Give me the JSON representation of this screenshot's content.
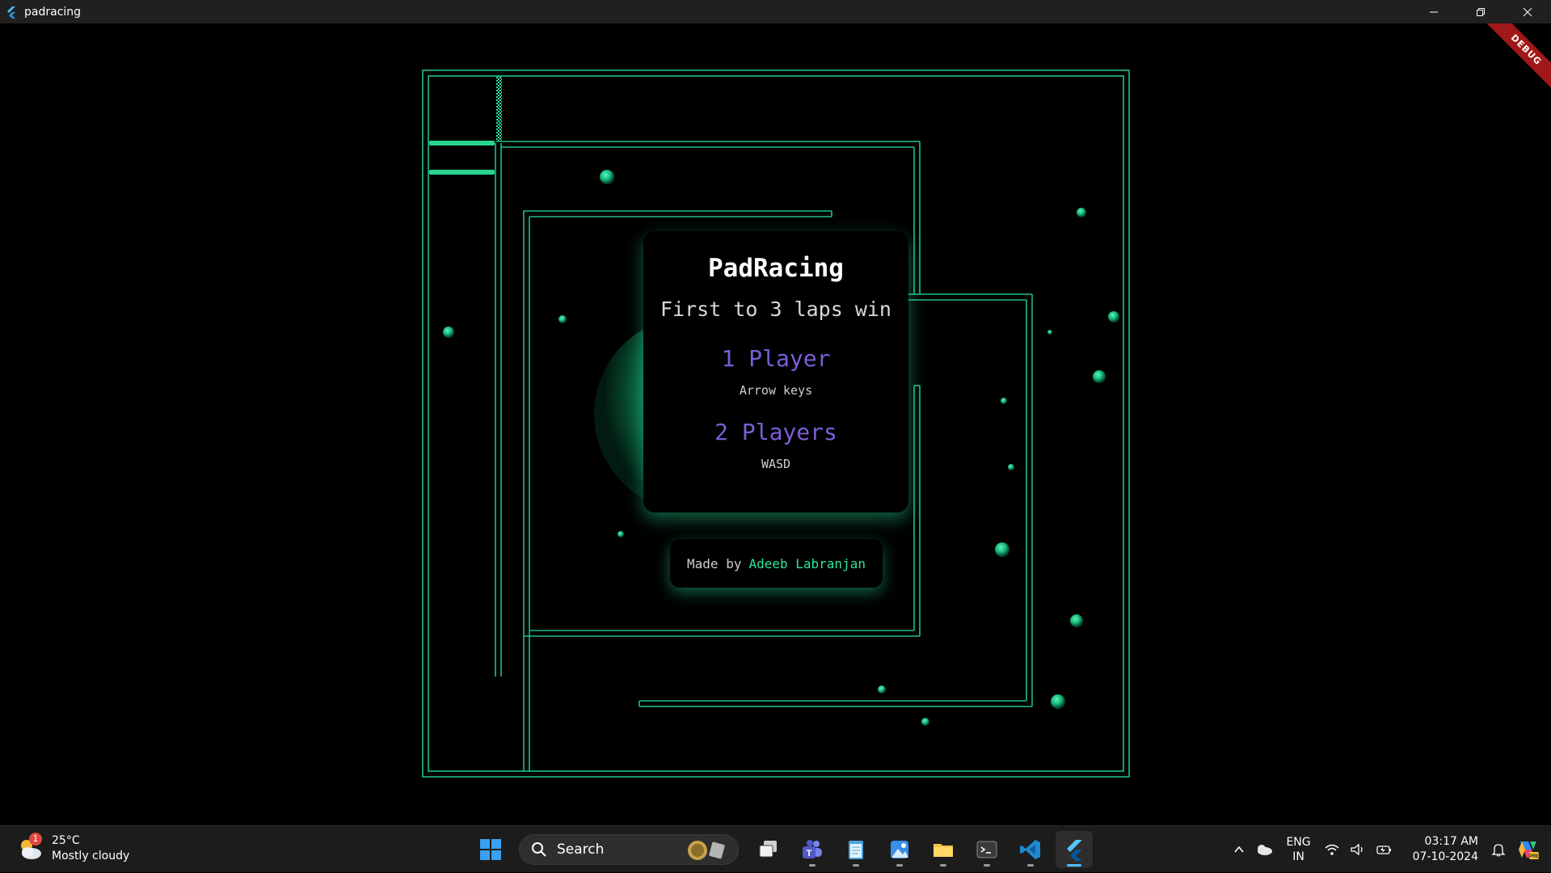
{
  "window": {
    "title": "padracing",
    "controls": [
      "minimize",
      "maximize",
      "close"
    ]
  },
  "app": {
    "debug_label": "DEBUG",
    "menu": {
      "title": "PadRacing",
      "subtitle": "First to 3 laps win",
      "options": [
        {
          "label": "1 Player",
          "hint": "Arrow keys"
        },
        {
          "label": "2 Players",
          "hint": "WASD"
        }
      ]
    },
    "credit": {
      "prefix": "Made by",
      "author": "Adeeb Labranjan"
    },
    "colors": {
      "track": "#1fbf83",
      "accent": "#2ee59a",
      "option": "#7a5fd6",
      "debug": "#a01818"
    }
  },
  "taskbar": {
    "weather": {
      "temp": "25°C",
      "condition": "Mostly cloudy",
      "badge": "1"
    },
    "search_label": "Search",
    "apps": [
      "start-icon",
      "task-view-icon",
      "teams-icon",
      "notepad-icon",
      "photos-icon",
      "file-explorer-icon",
      "terminal-icon",
      "vscode-icon",
      "flutter-icon"
    ],
    "tray": {
      "lang_line1": "ENG",
      "lang_line2": "IN",
      "time": "03:17 AM",
      "date": "07-10-2024"
    }
  }
}
